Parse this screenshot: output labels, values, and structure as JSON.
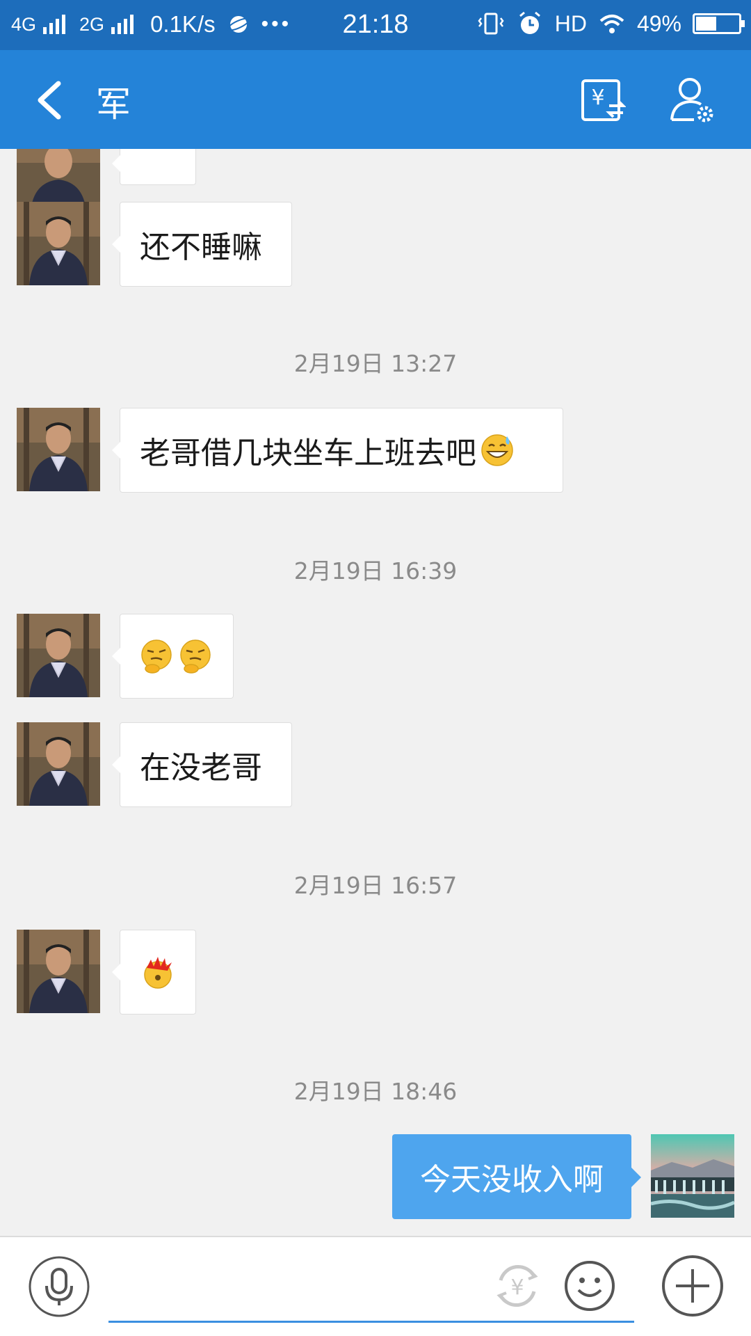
{
  "status_bar": {
    "network1": "4G",
    "network2": "2G",
    "speed": "0.1K/s",
    "dots": "•••",
    "time": "21:18",
    "hd": "HD",
    "battery": "49%",
    "battery_level": 0.49
  },
  "header": {
    "title": "军",
    "back_icon": "chevron-left-icon",
    "transfer_icon": "yuan-transfer-icon",
    "profile_icon": "user-settings-icon"
  },
  "chat": {
    "messages": [
      {
        "text": "还不睡嘛"
      },
      {
        "timestamp": "2月19日 13:27"
      },
      {
        "text": "老哥借几块坐车上班去吧",
        "emoji": "sweat-grin-emoji"
      },
      {
        "timestamp": "2月19日 16:39"
      },
      {
        "emoji": "thinking-face-emoji x2"
      },
      {
        "text": "在没老哥"
      },
      {
        "timestamp": "2月19日 16:57"
      },
      {
        "emoji": "exploding-head-emoji"
      },
      {
        "timestamp": "2月19日 18:46"
      },
      {
        "text": "今天没收入啊",
        "outgoing": true
      }
    ]
  },
  "input_bar": {
    "mic_icon": "microphone-icon",
    "transfer_icon": "yuan-transfer-icon",
    "emoji_icon": "smiley-icon",
    "plus_icon": "plus-icon"
  },
  "colors": {
    "status_bar": "#1d6dbb",
    "header": "#2483d8",
    "outgoing_bubble": "#4ea5ee",
    "background": "#f1f1f1"
  }
}
